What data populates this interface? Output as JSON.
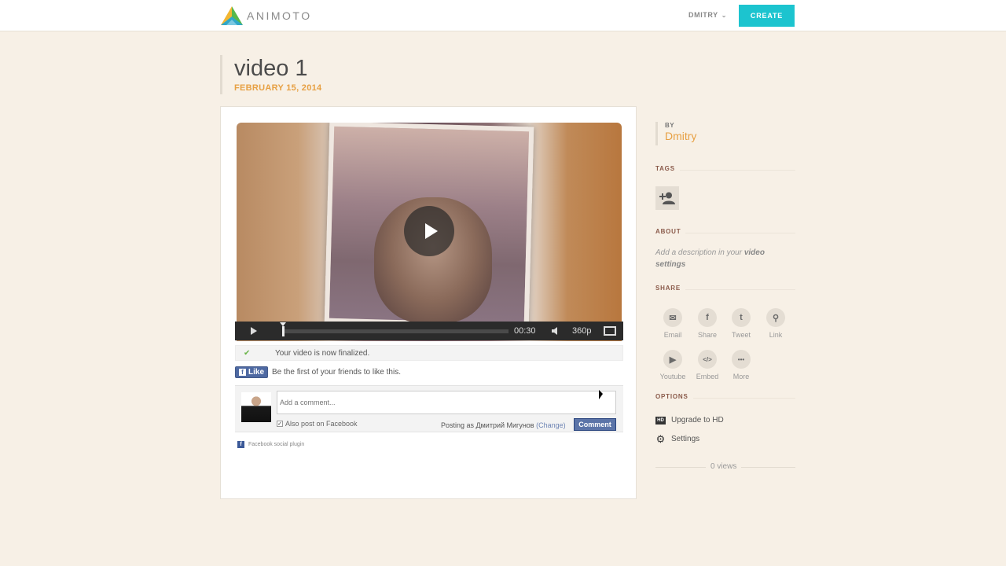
{
  "header": {
    "logo_text": "ANIMOTO",
    "user_name": "DMITRY",
    "create_label": "CREATE"
  },
  "video": {
    "title": "video 1",
    "date": "FEBRUARY 15, 2014",
    "time": "00:30",
    "quality": "360p",
    "status": "Your video is now finalized."
  },
  "facebook": {
    "like_label": "Like",
    "like_prompt": "Be the first of your friends to like this.",
    "comment_placeholder": "Add a comment...",
    "also_post": "Also post on Facebook",
    "posting_as": "Posting as Дмитрий Мигунов",
    "change_label": "(Change)",
    "comment_button": "Comment",
    "plugin_label": "Facebook social plugin"
  },
  "sidebar": {
    "by_label": "BY",
    "by_name": "Dmitry",
    "tags_label": "TAGS",
    "about_label": "ABOUT",
    "about_text_before": "Add a description in your ",
    "about_text_link": "video settings",
    "share_label": "SHARE",
    "share_items": [
      {
        "label": "Email",
        "icon": "email-icon",
        "glyph": "✉"
      },
      {
        "label": "Share",
        "icon": "facebook-icon",
        "glyph": "f"
      },
      {
        "label": "Tweet",
        "icon": "twitter-icon",
        "glyph": "t"
      },
      {
        "label": "Link",
        "icon": "link-icon",
        "glyph": "⚲"
      },
      {
        "label": "Youtube",
        "icon": "youtube-icon",
        "glyph": "▶"
      },
      {
        "label": "Embed",
        "icon": "embed-icon",
        "glyph": "</>"
      },
      {
        "label": "More",
        "icon": "more-icon",
        "glyph": "•••"
      }
    ],
    "options_label": "OPTIONS",
    "upgrade_label": "Upgrade to HD",
    "settings_label": "Settings",
    "views": "0 views"
  },
  "colors": {
    "accent": "#1cc4cf",
    "date": "#e7a043",
    "background": "#f7f0e6"
  }
}
